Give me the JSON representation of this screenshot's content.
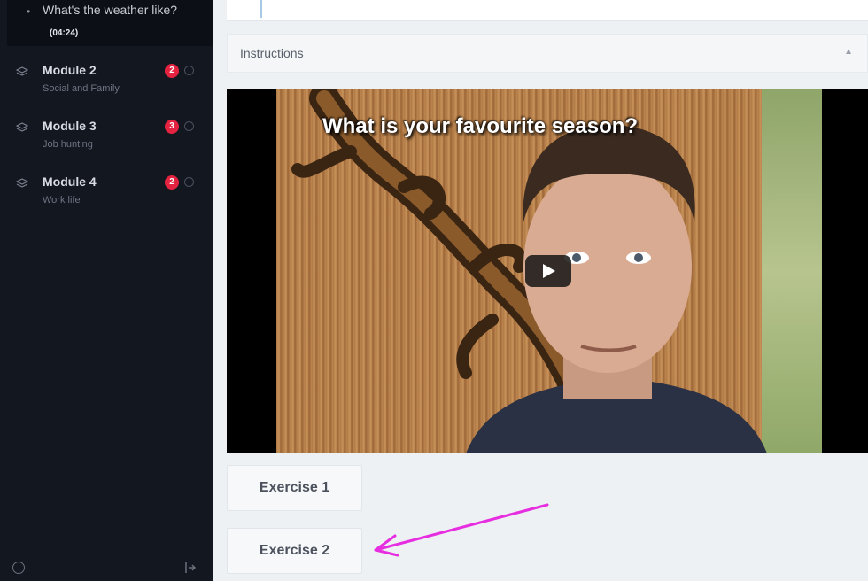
{
  "sidebar": {
    "current_lesson": {
      "title": "What's the weather like?",
      "time": "(04:24)"
    },
    "modules": [
      {
        "title": "Module 2",
        "subtitle": "Social and Family",
        "badge": "2"
      },
      {
        "title": "Module 3",
        "subtitle": "Job hunting",
        "badge": "3"
      },
      {
        "title": "Module 4",
        "subtitle": "Work life",
        "badge": "2"
      }
    ]
  },
  "main": {
    "instructions_label": "Instructions",
    "video": {
      "caption": "What is your favourite season?"
    },
    "exercises": [
      {
        "label": "Exercise 1"
      },
      {
        "label": "Exercise 2"
      }
    ]
  },
  "colors": {
    "sidebar_bg": "#131720",
    "badge": "#e3233f",
    "annotation_arrow": "#e62ee0"
  }
}
